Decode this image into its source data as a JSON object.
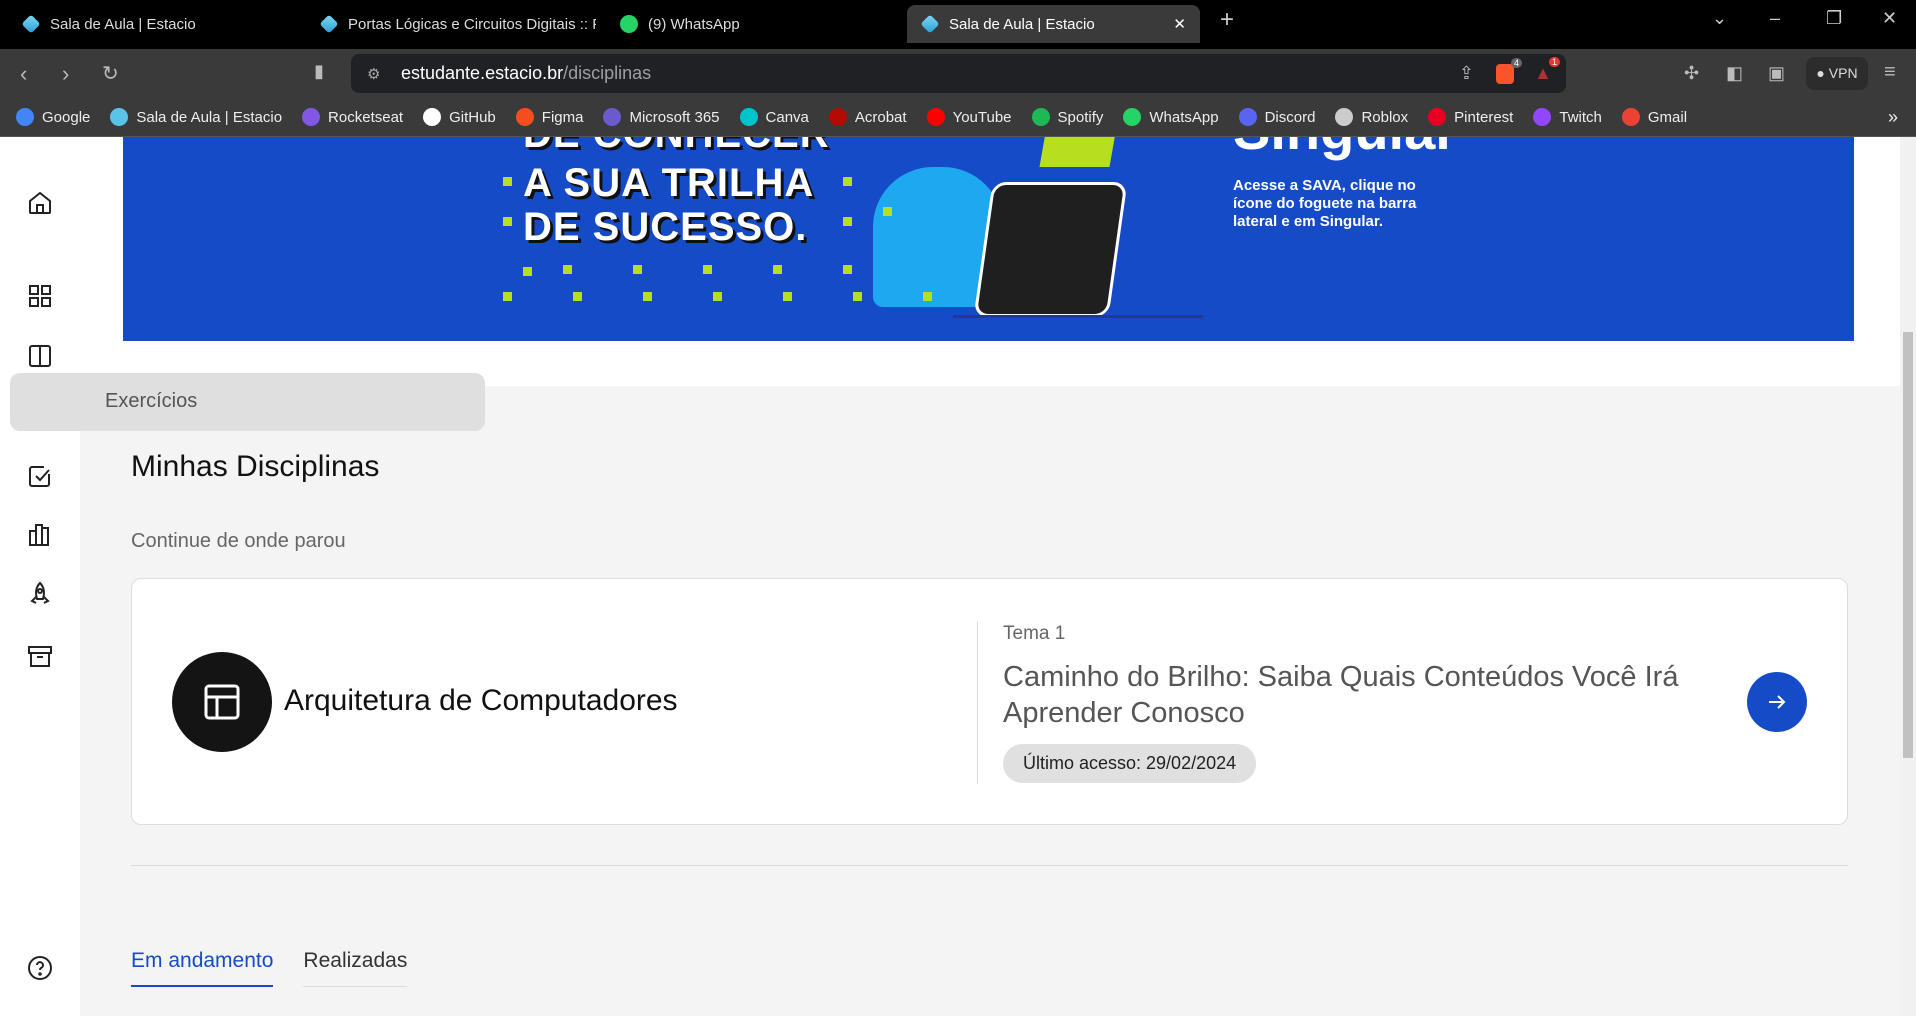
{
  "browser": {
    "tabs": [
      {
        "title": "Sala de Aula | Estacio"
      },
      {
        "title": "Portas Lógicas e Circuitos Digitais :: P"
      },
      {
        "title": "(9) WhatsApp"
      },
      {
        "title": "Sala de Aula | Estacio",
        "active": true
      }
    ],
    "url_host": "estudante.estacio.br",
    "url_path": "/disciplinas",
    "brave_badge": "4",
    "alert_badge": "1",
    "vpn_label": "VPN",
    "bookmarks": [
      {
        "label": "Google",
        "color": "#4285f4"
      },
      {
        "label": "Sala de Aula | Estacio",
        "color": "#5bc3ea"
      },
      {
        "label": "Rocketseat",
        "color": "#8257e5"
      },
      {
        "label": "GitHub",
        "color": "#ffffff"
      },
      {
        "label": "Figma",
        "color": "#f24e1e"
      },
      {
        "label": "Microsoft 365",
        "color": "#6a5acd"
      },
      {
        "label": "Canva",
        "color": "#00c4cc"
      },
      {
        "label": "Acrobat",
        "color": "#b30b00"
      },
      {
        "label": "YouTube",
        "color": "#ff0000"
      },
      {
        "label": "Spotify",
        "color": "#1db954"
      },
      {
        "label": "WhatsApp",
        "color": "#25d366"
      },
      {
        "label": "Discord",
        "color": "#5865f2"
      },
      {
        "label": "Roblox",
        "color": "#cccccc"
      },
      {
        "label": "Pinterest",
        "color": "#e60023"
      },
      {
        "label": "Twitch",
        "color": "#9146ff"
      },
      {
        "label": "Gmail",
        "color": "#ea4335"
      }
    ],
    "more": "»"
  },
  "banner": {
    "line1": "DE CONHECER",
    "line2": "A SUA TRILHA",
    "line3": "DE SUCESSO.",
    "heading": "Singular",
    "text": "Acesse a SAVA, clique no ícone do foguete na barra lateral e em Singular."
  },
  "sidebar": {
    "items": [
      "home-icon",
      "grid-icon",
      "book-icon",
      "clipboard-icon",
      "checkbox-icon",
      "library-icon",
      "rocket-icon",
      "archive-icon"
    ],
    "help": "help-icon",
    "tooltip": "Exercícios"
  },
  "main": {
    "title": "Minhas Disciplinas",
    "subtitle": "Continue de onde parou",
    "card": {
      "course": "Arquitetura de Computadores",
      "topic": "Tema 1",
      "lesson": "Caminho do Brilho: Saiba Quais Conteúdos Você Irá Aprender Conosco",
      "last_access": "Último acesso: 29/02/2024"
    },
    "tabs": [
      {
        "label": "Em andamento",
        "active": true
      },
      {
        "label": "Realizadas"
      }
    ]
  },
  "colors": {
    "accent": "#164bc8",
    "banner_dots": "#b6e01f"
  }
}
